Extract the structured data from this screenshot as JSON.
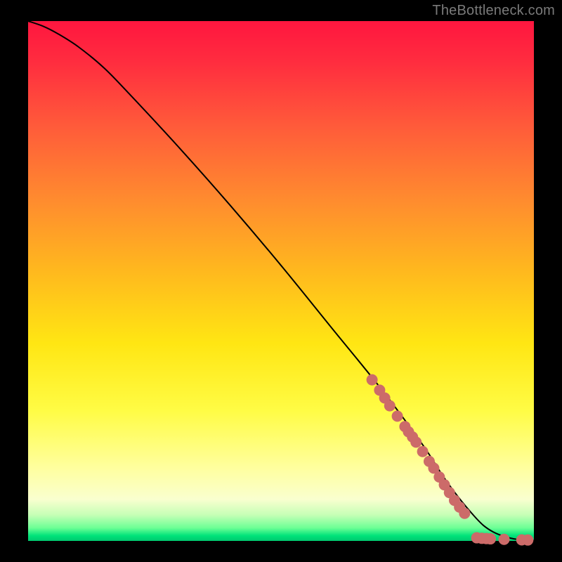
{
  "attribution": "TheBottleneck.com",
  "colors": {
    "marker": "#cc6b69",
    "curve": "#000000"
  },
  "chart_data": {
    "type": "line",
    "title": "",
    "xlabel": "",
    "ylabel": "",
    "xlim": [
      0,
      100
    ],
    "ylim": [
      0,
      100
    ],
    "grid": false,
    "legend": false,
    "series": [
      {
        "name": "curve",
        "x": [
          0,
          3,
          6,
          10,
          15,
          20,
          30,
          40,
          50,
          60,
          70,
          78,
          82,
          85,
          88,
          90,
          92,
          94,
          96,
          98,
          100
        ],
        "y": [
          100,
          99,
          97.5,
          95,
          91,
          86,
          75.5,
          64.5,
          53,
          41,
          29,
          18.5,
          12.5,
          8.5,
          5,
          3,
          1.7,
          0.9,
          0.4,
          0.15,
          0.1
        ]
      }
    ],
    "markers": [
      {
        "x": 68,
        "y": 31
      },
      {
        "x": 69.5,
        "y": 29
      },
      {
        "x": 70.5,
        "y": 27.5
      },
      {
        "x": 71.5,
        "y": 26
      },
      {
        "x": 73,
        "y": 24
      },
      {
        "x": 74.5,
        "y": 22
      },
      {
        "x": 75.2,
        "y": 21
      },
      {
        "x": 76,
        "y": 20
      },
      {
        "x": 76.7,
        "y": 19
      },
      {
        "x": 78,
        "y": 17.2
      },
      {
        "x": 79.3,
        "y": 15.3
      },
      {
        "x": 80.2,
        "y": 14
      },
      {
        "x": 81.3,
        "y": 12.3
      },
      {
        "x": 82.3,
        "y": 10.8
      },
      {
        "x": 83.3,
        "y": 9.3
      },
      {
        "x": 84.3,
        "y": 7.8
      },
      {
        "x": 85.3,
        "y": 6.5
      },
      {
        "x": 86.3,
        "y": 5.3
      },
      {
        "x": 88.7,
        "y": 0.6
      },
      {
        "x": 89.7,
        "y": 0.5
      },
      {
        "x": 90.6,
        "y": 0.45
      },
      {
        "x": 91.4,
        "y": 0.4
      },
      {
        "x": 94.1,
        "y": 0.3
      },
      {
        "x": 97.6,
        "y": 0.2
      },
      {
        "x": 98.8,
        "y": 0.18
      }
    ]
  }
}
